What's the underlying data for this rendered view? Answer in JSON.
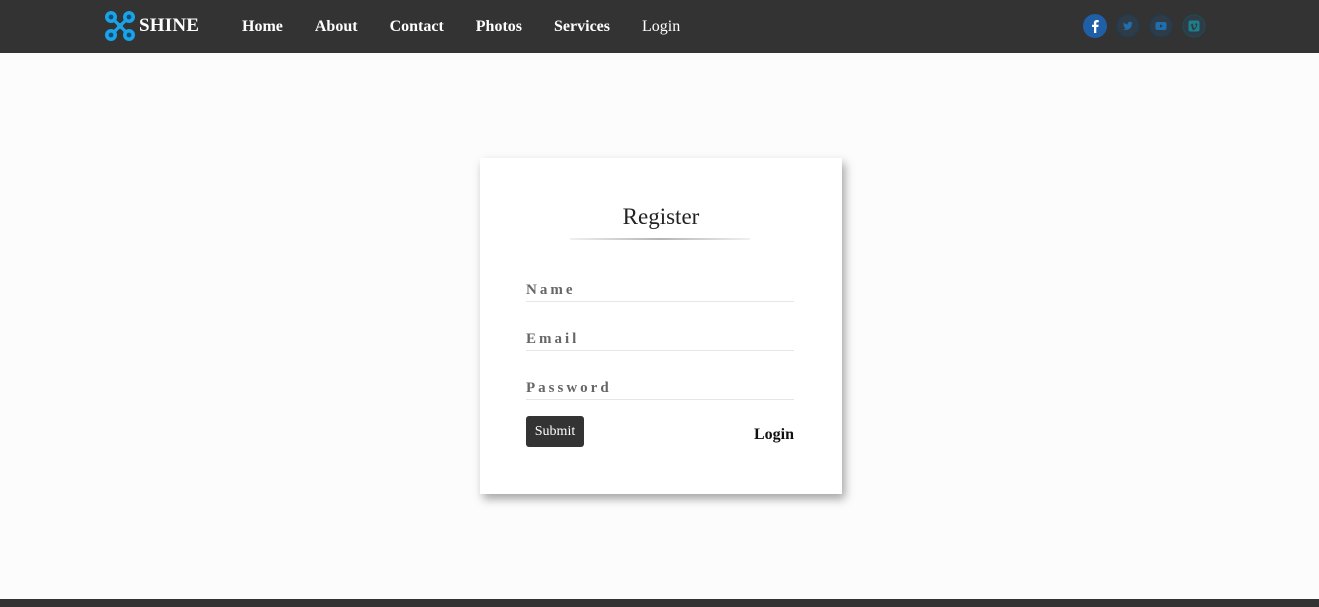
{
  "header": {
    "brand": "SHINE",
    "nav": [
      "Home",
      "About",
      "Contact",
      "Photos",
      "Services",
      "Login"
    ],
    "social": [
      "facebook-icon",
      "twitter-icon",
      "youtube-icon",
      "vimeo-icon"
    ]
  },
  "form": {
    "title": "Register",
    "name_placeholder": "Name",
    "email_placeholder": "Email",
    "password_placeholder": "Password",
    "name_value": "",
    "email_value": "",
    "password_value": "",
    "submit_label": "Submit",
    "login_label": "Login"
  },
  "colors": {
    "navbar": "#333333",
    "accent": "#1aa3e8",
    "page_bg": "#fcfcfc"
  }
}
